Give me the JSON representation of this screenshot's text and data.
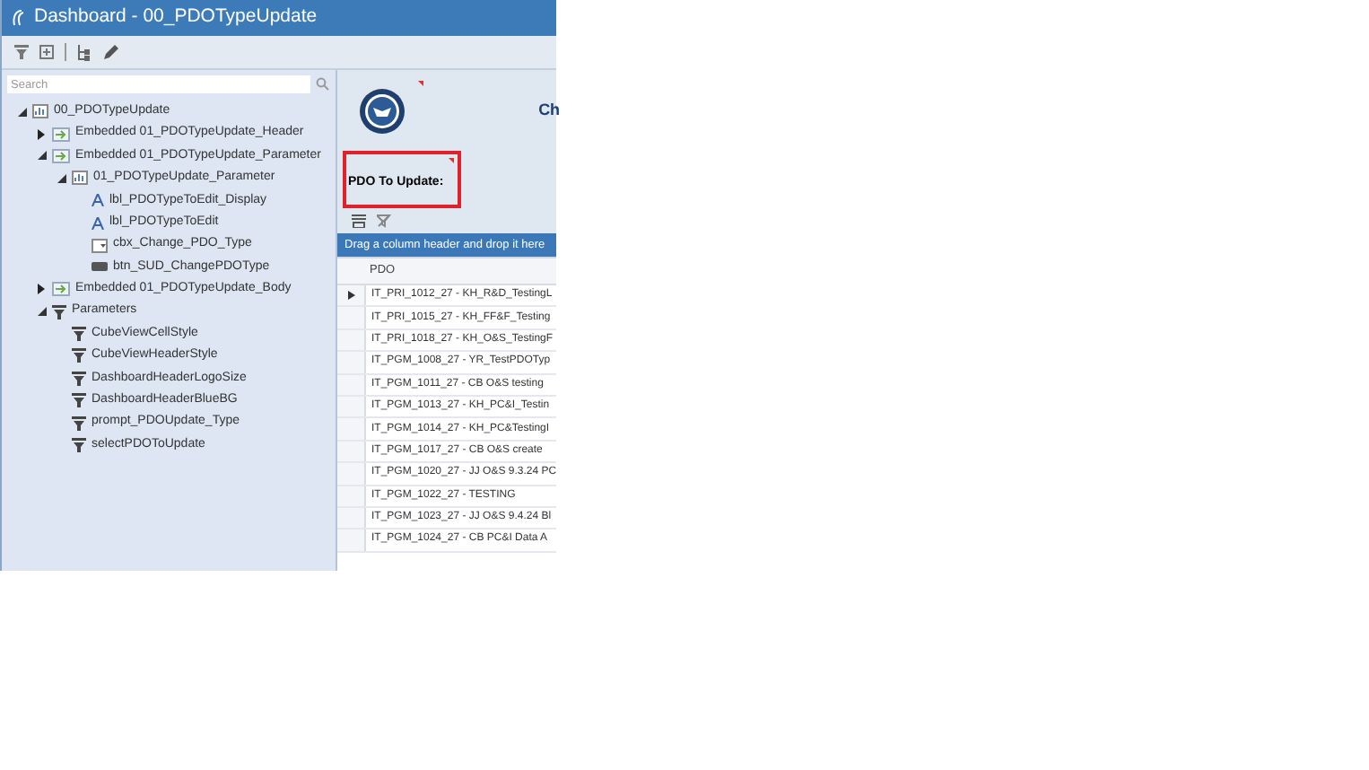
{
  "window": {
    "title": "Dashboard - 00_PDOTypeUpdate"
  },
  "search": {
    "placeholder": "Search"
  },
  "tree": [
    {
      "kind": "dashboard",
      "label": "00_PDOTypeUpdate",
      "expanded": true,
      "children": [
        {
          "kind": "embedded",
          "label": "Embedded 01_PDOTypeUpdate_Header",
          "expanded": false
        },
        {
          "kind": "embedded",
          "label": "Embedded 01_PDOTypeUpdate_Parameter",
          "expanded": true,
          "children": [
            {
              "kind": "dashboard",
              "label": "01_PDOTypeUpdate_Parameter",
              "expanded": true,
              "children": [
                {
                  "kind": "label",
                  "label": "lbl_PDOTypeToEdit_Display"
                },
                {
                  "kind": "label",
                  "label": "lbl_PDOTypeToEdit"
                },
                {
                  "kind": "combobox",
                  "label": "cbx_Change_PDO_Type"
                },
                {
                  "kind": "button",
                  "label": "btn_SUD_ChangePDOType"
                }
              ]
            }
          ]
        },
        {
          "kind": "embedded",
          "label": "Embedded 01_PDOTypeUpdate_Body",
          "expanded": false
        },
        {
          "kind": "parameter",
          "label": "Parameters",
          "expanded": true,
          "children": [
            {
              "kind": "parameter",
              "label": "CubeViewCellStyle"
            },
            {
              "kind": "parameter",
              "label": "CubeViewHeaderStyle"
            },
            {
              "kind": "parameter",
              "label": "DashboardHeaderLogoSize"
            },
            {
              "kind": "parameter",
              "label": "DashboardHeaderBlueBG"
            },
            {
              "kind": "parameter",
              "label": "prompt_PDOUpdate_Type"
            },
            {
              "kind": "parameter",
              "label": "selectPDOToUpdate"
            }
          ]
        }
      ]
    }
  ],
  "preview": {
    "header_title": "Ch",
    "label": "PDO To Update:",
    "group_hint": "Drag a column header and drop it here",
    "column": "PDO",
    "rows": [
      {
        "text": "IT_PRI_1012_27 - KH_R&D_TestingL",
        "current": true
      },
      {
        "text": "IT_PRI_1015_27 - KH_FF&F_Testing",
        "current": false
      },
      {
        "text": "IT_PRI_1018_27 - KH_O&S_TestingF",
        "current": false
      },
      {
        "text": "IT_PGM_1008_27 - YR_TestPDOTyp",
        "current": false
      },
      {
        "text": "IT_PGM_1011_27 - CB  O&S testing",
        "current": false
      },
      {
        "text": "IT_PGM_1013_27 - KH_PC&I_Testin",
        "current": false
      },
      {
        "text": "IT_PGM_1014_27 - KH_PC&TestingI",
        "current": false
      },
      {
        "text": "IT_PGM_1017_27 - CB O&S create",
        "current": false
      },
      {
        "text": "IT_PGM_1020_27 - JJ O&S 9.3.24 PC",
        "current": false
      },
      {
        "text": "IT_PGM_1022_27 - TESTING",
        "current": false
      },
      {
        "text": "IT_PGM_1023_27 - JJ O&S 9.4.24 Bl",
        "current": false
      },
      {
        "text": "IT_PGM_1024_27 - CB PC&I Data A",
        "current": false
      }
    ]
  }
}
